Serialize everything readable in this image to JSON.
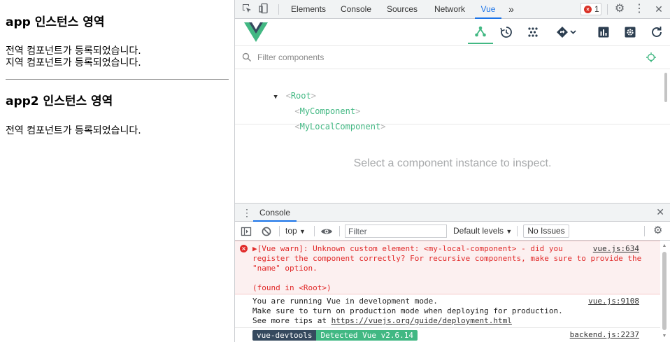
{
  "page": {
    "app1": {
      "title": "app 인스턴스 영역",
      "lines": [
        "전역 컴포넌트가 등록되었습니다.",
        "지역 컴포넌트가 등록되었습니다."
      ]
    },
    "app2": {
      "title": "app2 인스턴스 영역",
      "lines": [
        "전역 컴포넌트가 등록되었습니다."
      ]
    }
  },
  "devtools": {
    "tabs": [
      "Elements",
      "Console",
      "Sources",
      "Network",
      "Vue"
    ],
    "active_tab": "Vue",
    "more_tabs_glyph": "»",
    "error_count": "1",
    "error_glyph": "×",
    "settings_glyph": "⚙",
    "menu_glyph": "⋮",
    "close_glyph": "✕",
    "icons": [
      "inspect-element-icon",
      "device-toolbar-icon",
      "gear-icon",
      "kebab-menu-icon",
      "close-icon"
    ]
  },
  "vue_panel": {
    "header_icons": [
      "components-tree-icon",
      "timeline-icon",
      "vuex-icon",
      "router-icon",
      "performance-icon",
      "settings-icon",
      "refresh-icon"
    ],
    "accent": "#42b883",
    "filter_placeholder": "Filter components",
    "tree": [
      {
        "name": "Root",
        "depth": 0,
        "expanded": true
      },
      {
        "name": "MyComponent",
        "depth": 1
      },
      {
        "name": "MyLocalComponent",
        "depth": 1
      }
    ],
    "inspector_empty": "Select a component instance to inspect."
  },
  "console": {
    "tab_label": "Console",
    "menu_glyph": "⋮",
    "close_glyph": "✕",
    "context": "top",
    "filter_placeholder": "Filter",
    "levels": "Default levels",
    "no_issues": "No Issues",
    "messages": {
      "error": {
        "text": "▶[Vue warn]: Unknown custom element: <my-local-component> - did you\nregister the component correctly? For recursive components, make sure to provide the\n\"name\" option.\n\n(found in <Root>)",
        "source": "vue.js:634",
        "color": "#e12a2a"
      },
      "info": {
        "line1": "You are running Vue in development mode.",
        "line2": "Make sure to turn on production mode when deploying for production.",
        "line3_prefix": "See more tips at ",
        "link": "https://vuejs.org/guide/deployment.html",
        "source": "vue.js:9108"
      },
      "devtools": {
        "badge1": "vue-devtools",
        "badge2": "Detected Vue v2.6.14",
        "source": "backend.js:2237"
      }
    }
  }
}
